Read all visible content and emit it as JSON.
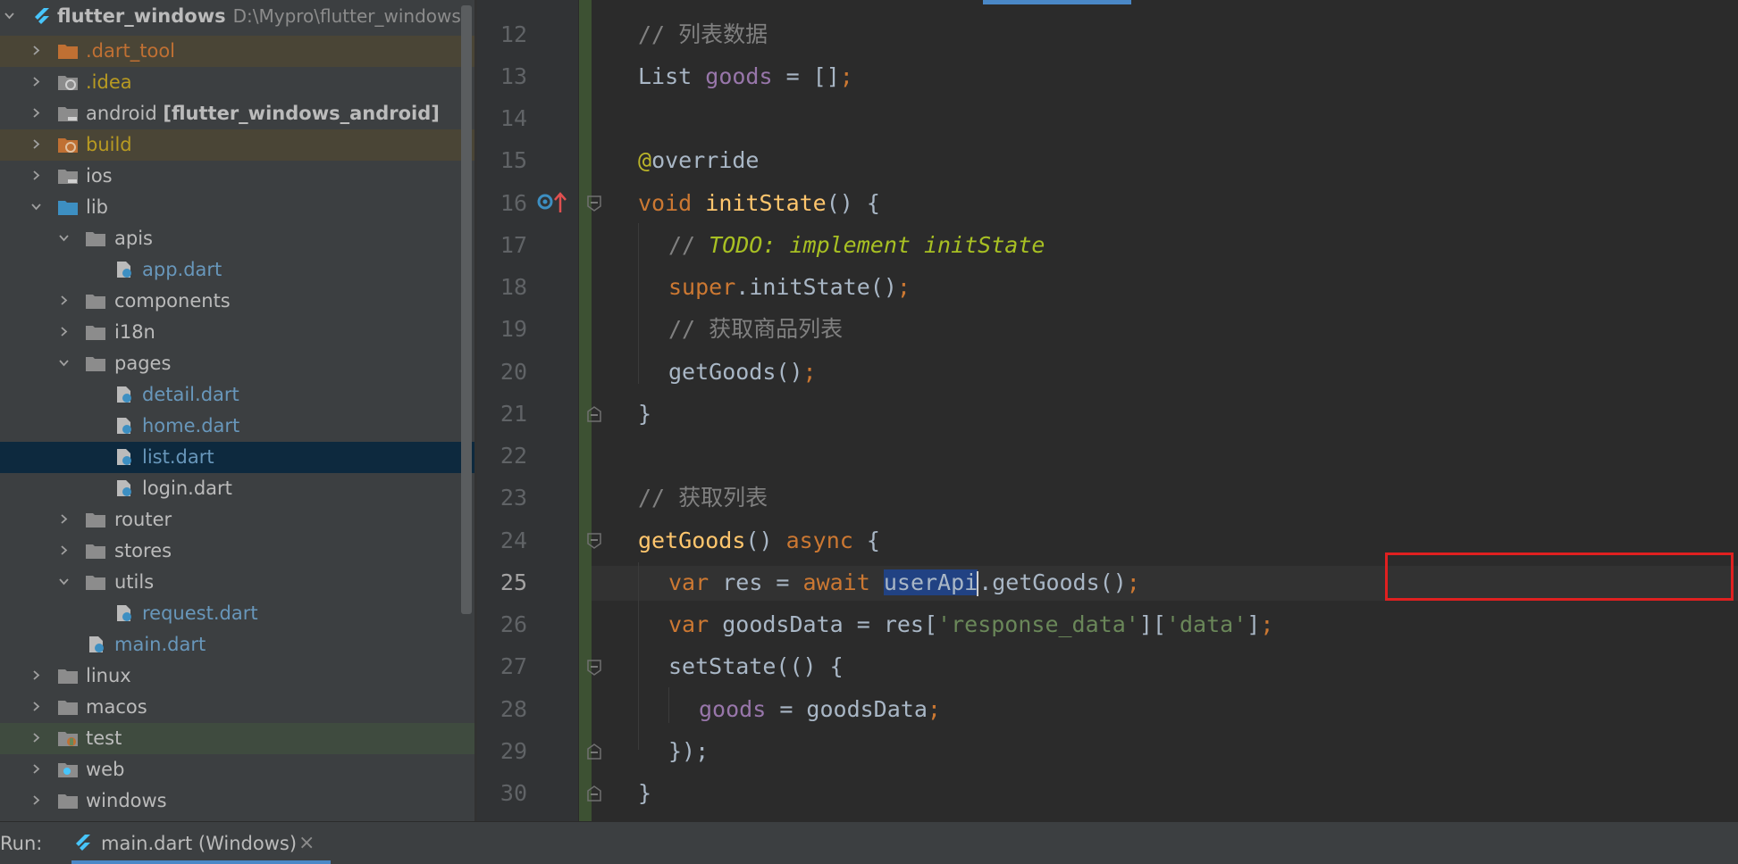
{
  "project": {
    "name": "flutter_windows",
    "path": "D:\\Mypro\\flutter_windows"
  },
  "tree": {
    "dart_tool": ".dart_tool",
    "idea": ".idea",
    "android": "android",
    "android_module": "[flutter_windows_android]",
    "build": "build",
    "ios": "ios",
    "lib": "lib",
    "apis": "apis",
    "app_dart": "app.dart",
    "components": "components",
    "i18n": "i18n",
    "pages": "pages",
    "detail_dart": "detail.dart",
    "home_dart": "home.dart",
    "list_dart": "list.dart",
    "login_dart": "login.dart",
    "router": "router",
    "stores": "stores",
    "utils": "utils",
    "request_dart": "request.dart",
    "main_dart": "main.dart",
    "linux": "linux",
    "macos": "macos",
    "test": "test",
    "web": "web",
    "windows": "windows"
  },
  "editor": {
    "line_numbers": [
      "12",
      "13",
      "14",
      "15",
      "16",
      "17",
      "18",
      "19",
      "20",
      "21",
      "22",
      "23",
      "24",
      "25",
      "26",
      "27",
      "28",
      "29",
      "30"
    ],
    "current_line": "25",
    "code": {
      "c1": "// ",
      "comment_list_data": "列表数据",
      "l13_type": "List ",
      "l13_field": "goods",
      "l13_eq": " = []",
      "semi": ";",
      "at": "@",
      "override": "override",
      "void": "void ",
      "initState": "initState",
      "parens_brace": "() {",
      "l17_slash": "// ",
      "todo": "TODO: implement initState",
      "super": "super",
      "dot_init": ".initState()",
      "comment_get_goods_list": "获取商品列表",
      "getGoods_call": "getGoods()",
      "close_brace": "}",
      "comment_get_list": "获取列表",
      "getGoods_def": "getGoods",
      "async": "async",
      "brace_open": "{",
      "var": "var ",
      "res_eq": "res = ",
      "await": "await ",
      "userApi": "userApi",
      "dot_getGoods": ".getGoods()",
      "goodsData_eq": "goodsData = res[",
      "s_response_data": "'response_data'",
      "bracket_mid": "][",
      "s_data": "'data'",
      "bracket_end": "]",
      "setState": "setState(() {",
      "goods": "goods",
      "eq_goodsData": " = goodsData",
      "close_paren": "});",
      "parens": "() "
    }
  },
  "run_bar": {
    "label": "Run:",
    "tab": "main.dart (Windows)",
    "close": "×"
  },
  "colors": {
    "keyword": "#cc7832",
    "comment": "#808080",
    "string": "#6a8759",
    "function": "#ffc66d",
    "field": "#9876aa",
    "annotation": "#bbb529",
    "todo": "#a8c023",
    "highlight_box": "#e02020"
  }
}
